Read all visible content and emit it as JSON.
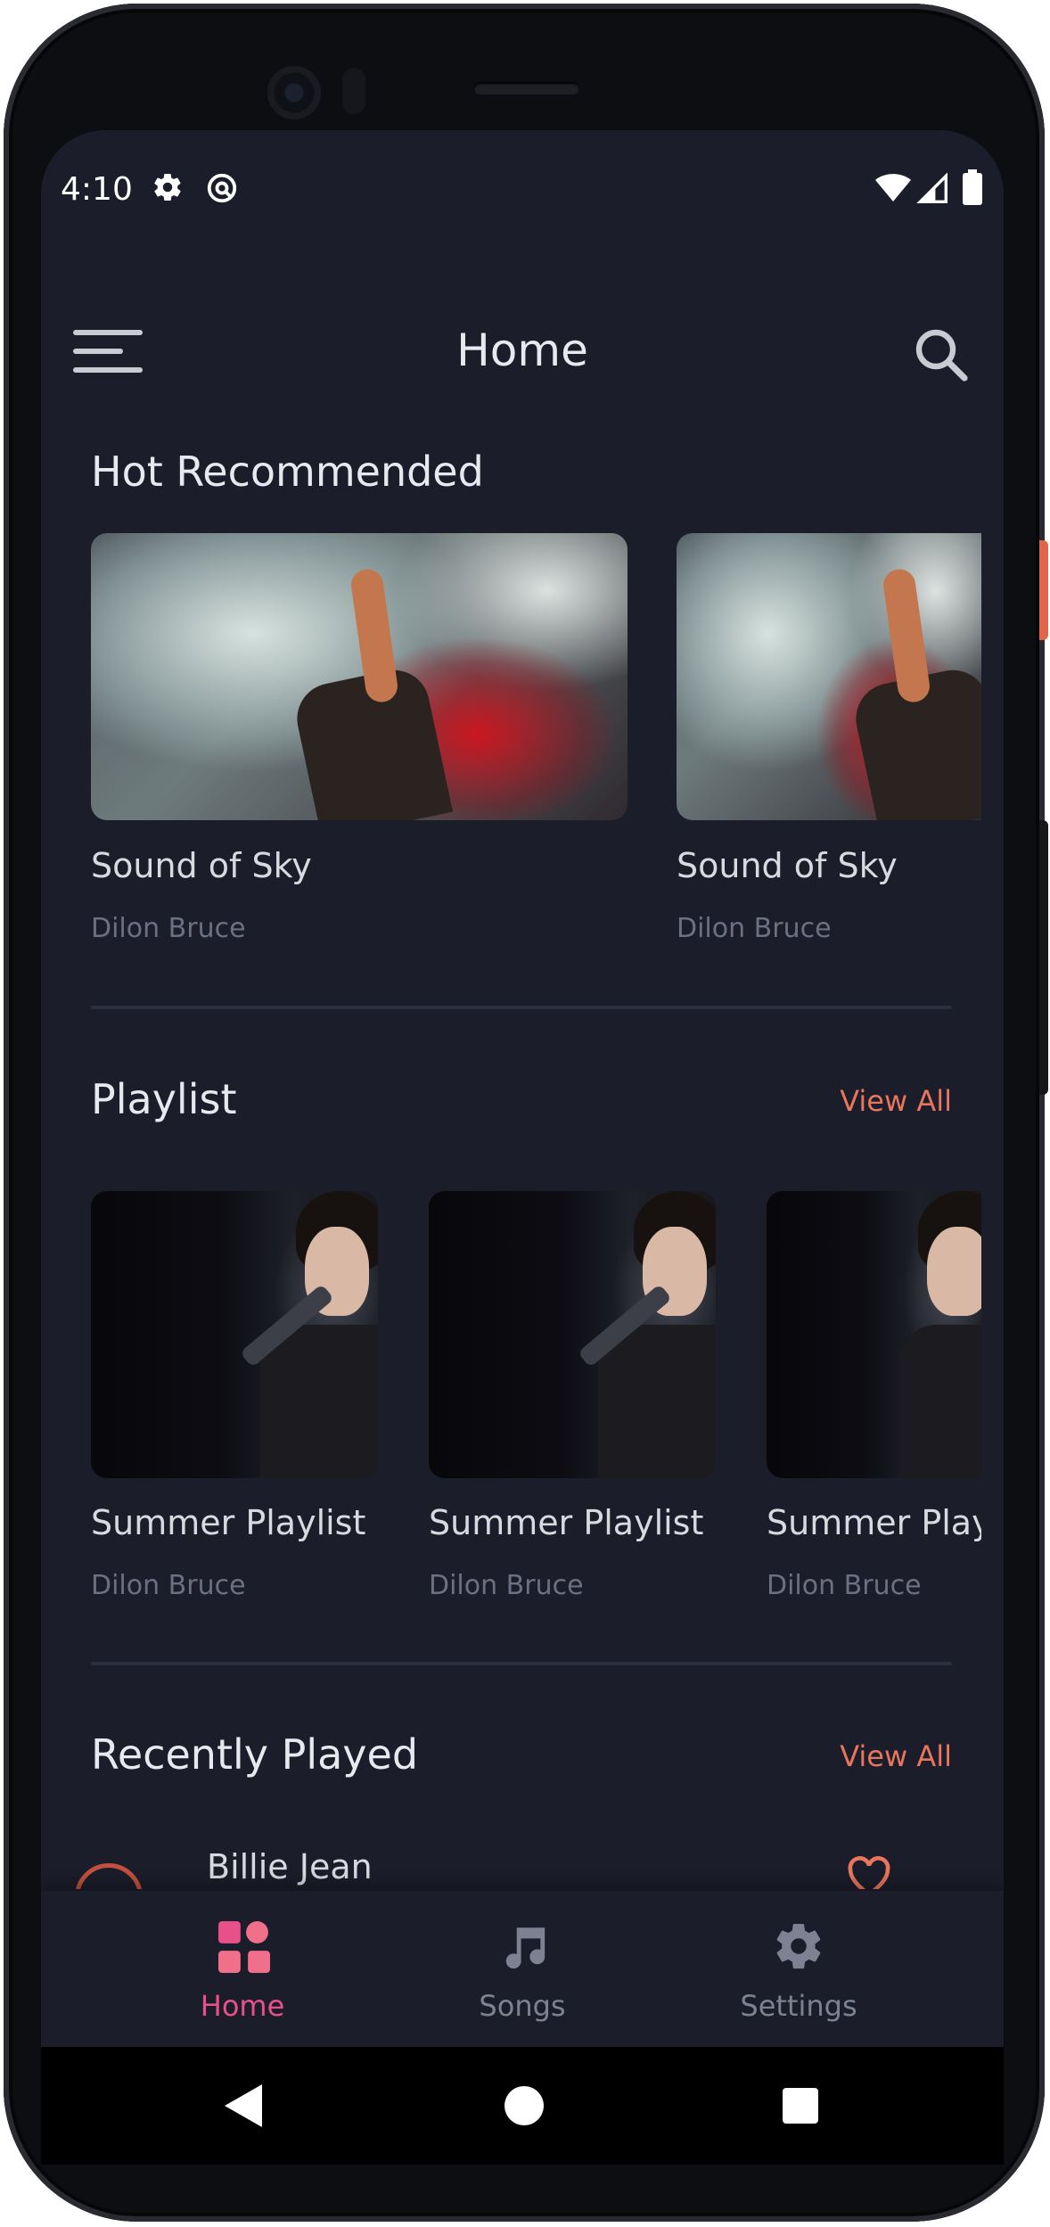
{
  "status_bar": {
    "time": "4:10",
    "icons": [
      "gear-icon",
      "at-icon",
      "wifi-icon",
      "cell-signal-icon",
      "battery-icon"
    ]
  },
  "header": {
    "title": "Home",
    "left_icon": "menu-icon",
    "right_icon": "search-icon"
  },
  "hot_recommended": {
    "title": "Hot Recommended",
    "items": [
      {
        "title": "Sound of Sky",
        "artist": "Dilon Bruce"
      },
      {
        "title": "Sound of Sky",
        "artist": "Dilon Bruce"
      }
    ]
  },
  "playlist": {
    "title": "Playlist",
    "view_all": "View All",
    "items": [
      {
        "title": "Summer Playlist",
        "artist": "Dilon Bruce"
      },
      {
        "title": "Summer Playlist",
        "artist": "Dilon Bruce"
      },
      {
        "title": "Summer Playlist",
        "artist": "Dilon Bruce"
      }
    ]
  },
  "recently_played": {
    "title": "Recently Played",
    "view_all": "View All",
    "items": [
      {
        "title": "Billie Jean"
      }
    ]
  },
  "bottom_nav": {
    "items": [
      {
        "label": "Home",
        "icon": "grid-icon",
        "active": true
      },
      {
        "label": "Songs",
        "icon": "music-note-icon",
        "active": false
      },
      {
        "label": "Settings",
        "icon": "gear-icon",
        "active": false
      }
    ]
  },
  "colors": {
    "background": "#1b1d2b",
    "accent_orange": "#e8765c",
    "accent_pink": "#e8508a",
    "text_primary": "#e8e9ee",
    "text_secondary": "#6d7082"
  }
}
